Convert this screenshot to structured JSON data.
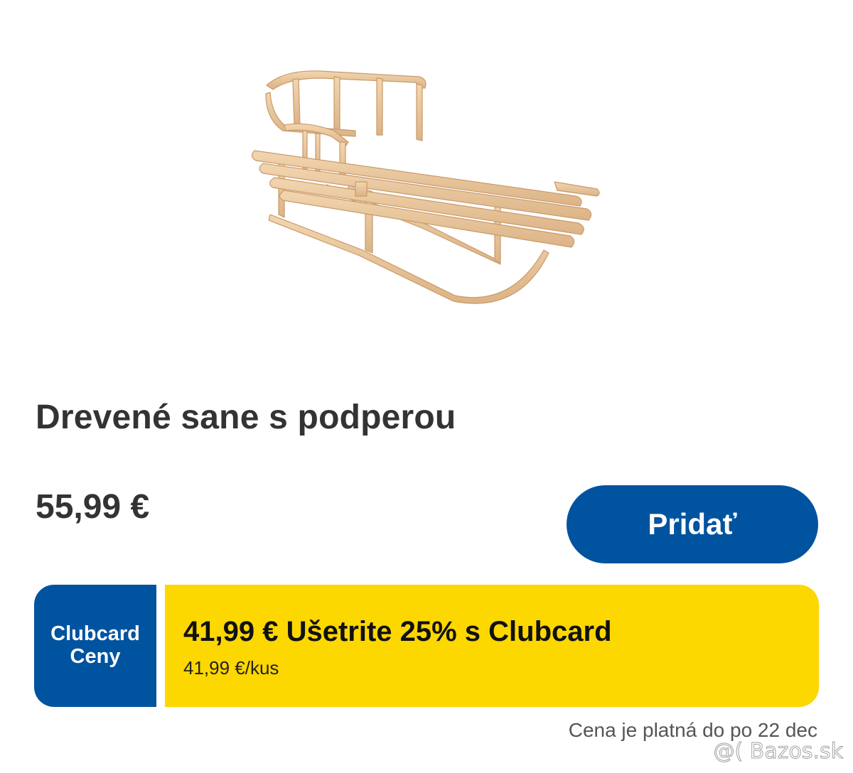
{
  "product": {
    "image_icon": "wooden-sled-image",
    "title": "Drevené sane s podperou",
    "price": "55,99 €"
  },
  "actions": {
    "add_label": "Pridať"
  },
  "clubcard": {
    "badge_line1": "Clubcard",
    "badge_line2": "Ceny",
    "offer_main": "41,99 € Ušetrite 25% s Clubcard",
    "offer_unit": "41,99 €/kus"
  },
  "validity": "Cena je platná do po 22 dec",
  "watermark": "@( Bazos.sk",
  "colors": {
    "brand_blue": "#00539f",
    "clubcard_yellow": "#fcd700",
    "text_dark": "#333333"
  }
}
